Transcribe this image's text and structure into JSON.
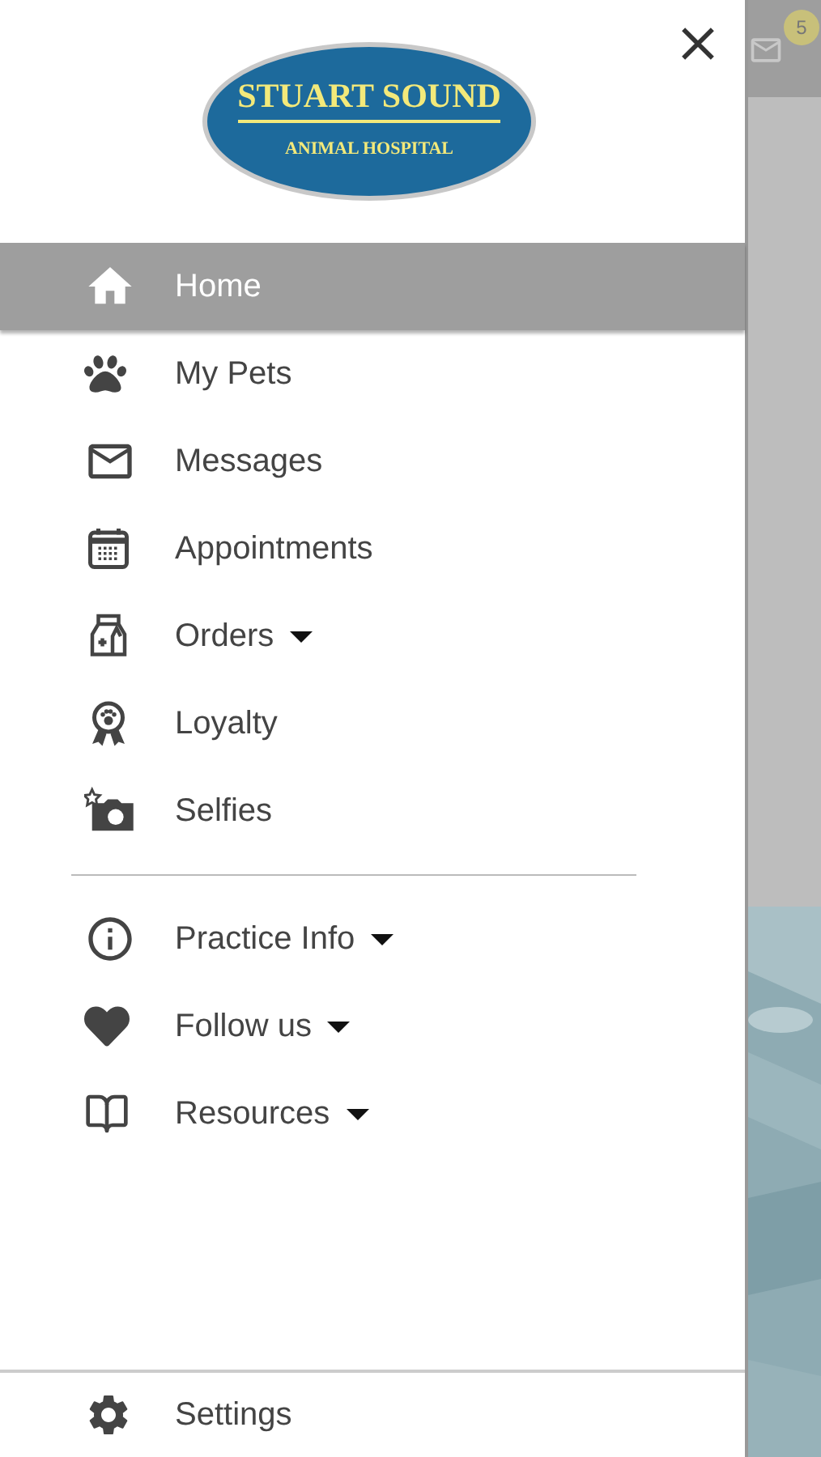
{
  "logo": {
    "title": "STUART SOUND",
    "subtitle": "ANIMAL HOSPITAL"
  },
  "background": {
    "badge": "5"
  },
  "menu": [
    {
      "label": "Home",
      "selected": true,
      "has_submenu": false
    },
    {
      "label": "My Pets",
      "selected": false,
      "has_submenu": false
    },
    {
      "label": "Messages",
      "selected": false,
      "has_submenu": false
    },
    {
      "label": "Appointments",
      "selected": false,
      "has_submenu": false
    },
    {
      "label": "Orders",
      "selected": false,
      "has_submenu": true
    },
    {
      "label": "Loyalty",
      "selected": false,
      "has_submenu": false
    },
    {
      "label": "Selfies",
      "selected": false,
      "has_submenu": false
    }
  ],
  "secondary_menu": [
    {
      "label": "Practice Info",
      "selected": false,
      "has_submenu": true
    },
    {
      "label": "Follow us",
      "selected": false,
      "has_submenu": true
    },
    {
      "label": "Resources",
      "selected": false,
      "has_submenu": true
    }
  ],
  "footer": {
    "label": "Settings"
  }
}
